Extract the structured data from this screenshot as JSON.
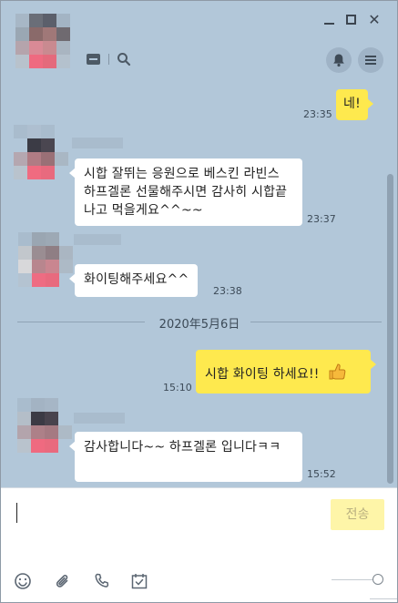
{
  "window": {
    "controls": {
      "minimize": "minimize-icon",
      "maximize": "maximize-icon",
      "close": "close-icon"
    },
    "close_glyph": "✕"
  },
  "header": {
    "icons": [
      "folder-icon",
      "search-icon",
      "bell-icon",
      "menu-icon"
    ]
  },
  "messages": [
    {
      "side": "out",
      "text": "네!",
      "time": "23:35"
    },
    {
      "side": "in",
      "text": "시합 잘뛰는 응원으로 베스킨 라빈스 하프겔론 선물해주시면  감사히  시합끝나고 먹을게요^^~~",
      "time": "23:37"
    },
    {
      "side": "in",
      "text": "화이팅해주세요^^",
      "time": "23:38"
    },
    {
      "side": "out",
      "text": "시합 화이팅 하세요!!",
      "time": "15:10",
      "emoji": "thumbs-up-icon"
    },
    {
      "side": "in",
      "text": "감사합니다~~ 하프겔론 입니다ㅋㅋ",
      "time": "15:52"
    }
  ],
  "date_divider": "2020年5月6日",
  "input": {
    "value": "",
    "send_label": "전송"
  },
  "toolbar": {
    "icons": [
      "emoticon-icon",
      "attach-icon",
      "phone-icon",
      "calendar-icon"
    ]
  },
  "colors": {
    "background": "#b2c7d9",
    "my_bubble": "#fee94e",
    "their_bubble": "#ffffff",
    "send_button": "#fef5a8"
  }
}
